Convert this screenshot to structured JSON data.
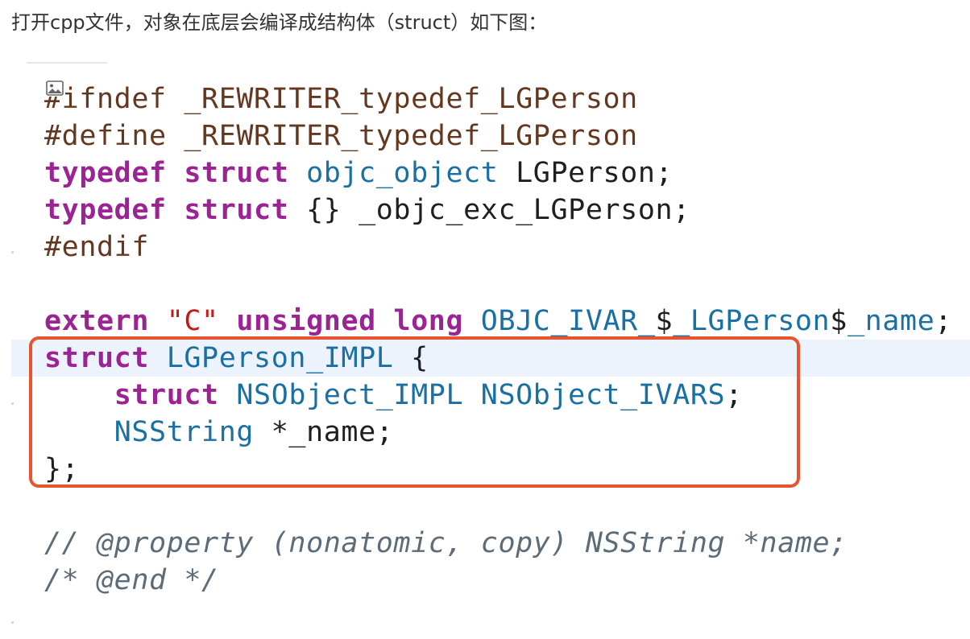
{
  "intro_text": "打开cpp文件，对象在底层会编译成结构体（struct）如下图：",
  "colors": {
    "keyword": "#9b2393",
    "preprocessor": "#643820",
    "type": "#1a6fa3",
    "string": "#c41a16",
    "comment": "#5d6c79",
    "highlight_border": "#e9542f",
    "current_line": "#edf3fd"
  },
  "code": {
    "lines": [
      [
        {
          "t": "pp",
          "v": "#ifndef _REWRITER_typedef_LGPerson"
        }
      ],
      [
        {
          "t": "pp",
          "v": "#define _REWRITER_typedef_LGPerson"
        }
      ],
      [
        {
          "t": "kw",
          "v": "typedef"
        },
        {
          "t": "plain",
          "v": " "
        },
        {
          "t": "kw",
          "v": "struct"
        },
        {
          "t": "plain",
          "v": " "
        },
        {
          "t": "ty",
          "v": "objc_object"
        },
        {
          "t": "plain",
          "v": " LGPerson;"
        }
      ],
      [
        {
          "t": "kw",
          "v": "typedef"
        },
        {
          "t": "plain",
          "v": " "
        },
        {
          "t": "kw",
          "v": "struct"
        },
        {
          "t": "plain",
          "v": " {} _objc_exc_LGPerson;"
        }
      ],
      [
        {
          "t": "pp",
          "v": "#endif"
        }
      ],
      [],
      [
        {
          "t": "kw",
          "v": "extern"
        },
        {
          "t": "plain",
          "v": " "
        },
        {
          "t": "str",
          "v": "\"C\""
        },
        {
          "t": "plain",
          "v": " "
        },
        {
          "t": "kw",
          "v": "unsigned"
        },
        {
          "t": "plain",
          "v": " "
        },
        {
          "t": "kw",
          "v": "long"
        },
        {
          "t": "plain",
          "v": " "
        },
        {
          "t": "ty",
          "v": "OBJC_IVAR_"
        },
        {
          "t": "plain",
          "v": "$"
        },
        {
          "t": "ty",
          "v": "_LGPerson"
        },
        {
          "t": "plain",
          "v": "$"
        },
        {
          "t": "ty",
          "v": "_name"
        },
        {
          "t": "plain",
          "v": ";"
        }
      ],
      [
        {
          "t": "kw",
          "v": "struct"
        },
        {
          "t": "plain",
          "v": " "
        },
        {
          "t": "ty",
          "v": "LGPerson_IMPL"
        },
        {
          "t": "plain",
          "v": " {"
        }
      ],
      [
        {
          "t": "plain",
          "v": "    "
        },
        {
          "t": "kw",
          "v": "struct"
        },
        {
          "t": "plain",
          "v": " "
        },
        {
          "t": "ty",
          "v": "NSObject_IMPL"
        },
        {
          "t": "plain",
          "v": " "
        },
        {
          "t": "ty",
          "v": "NSObject_IVARS"
        },
        {
          "t": "plain",
          "v": ";"
        }
      ],
      [
        {
          "t": "plain",
          "v": "    "
        },
        {
          "t": "ty",
          "v": "NSString"
        },
        {
          "t": "plain",
          "v": " *_name;"
        }
      ],
      [
        {
          "t": "plain",
          "v": "};"
        }
      ],
      [],
      [
        {
          "t": "cm",
          "v": "// @property (nonatomic, copy) NSString *name;"
        }
      ],
      [
        {
          "t": "cm",
          "v": "/* @end */"
        }
      ]
    ]
  }
}
